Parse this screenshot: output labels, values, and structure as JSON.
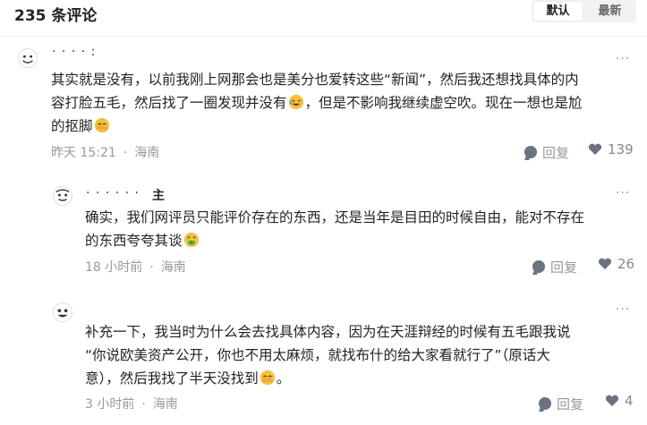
{
  "header": {
    "title": "235 条评论",
    "sort_default": "默认",
    "sort_latest": "最新"
  },
  "comments": [
    {
      "username": "· · · · :",
      "text_line1": "其实就是没有，以前我刚上网那会也是美分也爱转这些“新闻”，然后我还想找具体的内",
      "text_line2a": "容打脸五毛，然后找了一圈发现并没有",
      "text_line2b": "，但是不影响我继续虚空吹。现在一想也是尬",
      "text_line3": "的抠脚",
      "time": "昨天 15:21",
      "location": "海南",
      "reply_label": "回复",
      "likes": "139"
    },
    {
      "username": "· · · · · ·",
      "author_badge": "主",
      "text_line1": "确实，我们网评员只能评价存在的东西，还是当年是目田的时候自由，能对不存在",
      "text_line2": "的东西夸夸其谈",
      "time": "18 小时前",
      "location": "海南",
      "reply_label": "回复",
      "likes": "26"
    },
    {
      "username": "",
      "text_line1": "补充一下，我当时为什么会去找具体内容，因为在天涯辩经的时候有五毛跟我说",
      "text_line2": "“你说欧美资产公开，你也不用太麻烦，就找布什的给大家看就行了”（原话大",
      "text_line3": "意），然后我找了半天没找到",
      "text_line3_end": "。",
      "time": "3 小时前",
      "location": "海南",
      "reply_label": "回复",
      "likes": "4"
    }
  ],
  "more_icon": "···",
  "colors": {
    "text": "#222222",
    "meta": "#999999",
    "icon": "#6b7280",
    "divider": "#eeeeee",
    "emoji_yellow": "#f5c13d"
  },
  "icons": [
    "avatar-icon",
    "more-icon",
    "reply-icon",
    "heart-icon",
    "rofl-emoji-icon",
    "facepalm-emoji-icon",
    "money-mouth-emoji-icon"
  ]
}
